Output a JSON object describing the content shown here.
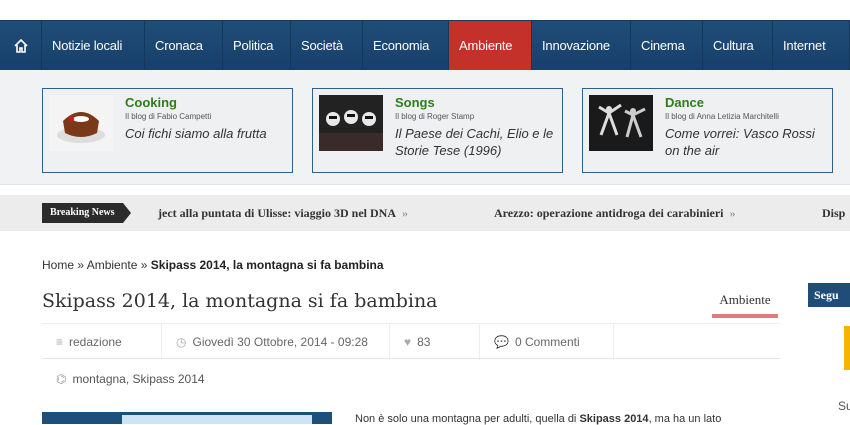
{
  "nav": {
    "items": [
      "Notizie locali",
      "Cronaca",
      "Politica",
      "Società",
      "Economia",
      "Ambiente",
      "Innovazione",
      "Cinema",
      "Cultura",
      "Internet"
    ],
    "active": "Ambiente"
  },
  "blogs": [
    {
      "category": "Cooking",
      "author": "Il blog di Fabio Campetti",
      "post": "Coi fichi siamo alla frutta"
    },
    {
      "category": "Songs",
      "author": "Il blog di Roger Stamp",
      "post": "Il Paese dei Cachi, Elio e le Storie Tese (1996)"
    },
    {
      "category": "Dance",
      "author": "Il blog di Anna Letizia Marchitelli",
      "post": "Come vorrei: Vasco Rossi on the air"
    }
  ],
  "ticker": {
    "label": "Breaking News",
    "items": [
      "ject alla puntata di Ulisse: viaggio 3D nel DNA",
      "Arezzo: operazione antidroga dei carabinieri",
      "Disp"
    ],
    "separator": "»"
  },
  "breadcrumb": {
    "home": "Home",
    "sep": "»",
    "section": "Ambiente",
    "current": "Skipass 2014, la montagna si fa bambina"
  },
  "article": {
    "title": "Skipass 2014, la montagna si fa bambina",
    "category": "Ambiente",
    "author": "redazione",
    "date": "Giovedì 30 Ottobre, 2014 - 09:28",
    "likes": "83",
    "comments": "0 Commenti",
    "tags": "montagna, Skipass 2014",
    "teaser_prefix": "Non è solo una montagna per adulti, quella di ",
    "teaser_bold": "Skipass 2014",
    "teaser_suffix": ", ma ha un lato"
  },
  "sidebar": {
    "head": "Segu",
    "text": "Su"
  }
}
